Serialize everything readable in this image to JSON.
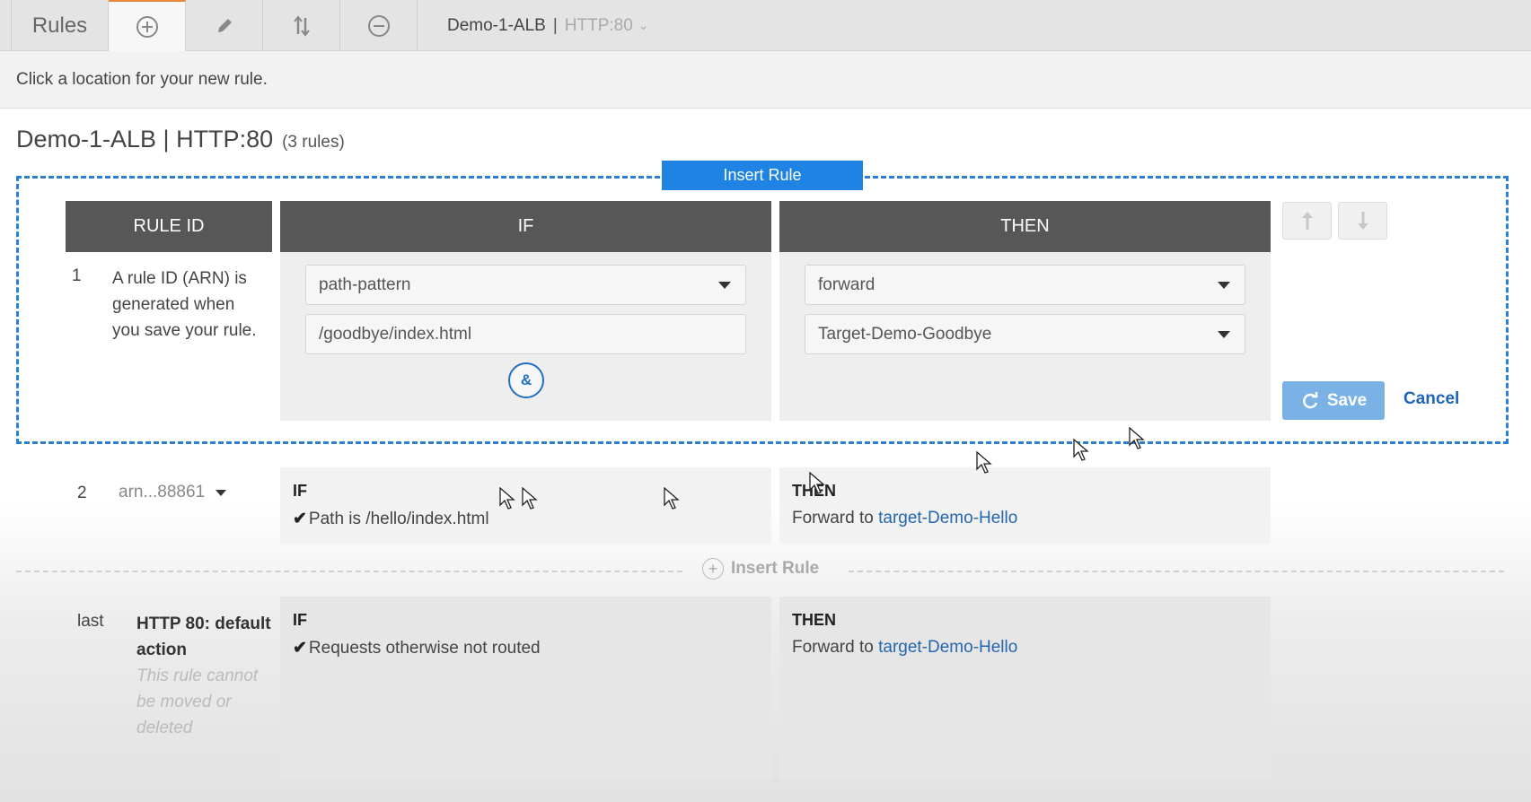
{
  "toolbar": {
    "rules_label": "Rules",
    "listener_name": "Demo-1-ALB",
    "listener_sep": "|",
    "listener_port": "HTTP:80"
  },
  "instruction": "Click a location for your new rule.",
  "heading": {
    "title": "Demo-1-ALB | HTTP:80",
    "count": "(3 rules)"
  },
  "new_rule": {
    "insert_tag": "Insert Rule",
    "columns": {
      "rule_id": "RULE ID",
      "if": "IF",
      "then": "THEN"
    },
    "number": "1",
    "description": "A rule ID (ARN) is generated when you save your rule.",
    "condition_type": "path-pattern",
    "condition_value": "/goodbye/index.html",
    "and_label": "&",
    "action_type": "forward",
    "target_group": "Target-Demo-Goodbye",
    "save_label": "Save",
    "cancel_label": "Cancel"
  },
  "rules": [
    {
      "number": "2",
      "arn": "arn...88861",
      "if_label": "IF",
      "condition": "Path is /hello/index.html",
      "then_label": "THEN",
      "action_prefix": "Forward to",
      "target": "target-Demo-Hello"
    }
  ],
  "insert_rule_label": "Insert Rule",
  "default_rule": {
    "number": "last",
    "title": "HTTP 80: default action",
    "note": "This rule cannot be moved or deleted",
    "if_label": "IF",
    "condition": "Requests otherwise not routed",
    "then_label": "THEN",
    "action_prefix": "Forward to",
    "target": "target-Demo-Hello"
  },
  "colors": {
    "accent": "#1f83e3",
    "header": "#575757",
    "link": "#2466b0",
    "save": "#7ab2e6"
  }
}
